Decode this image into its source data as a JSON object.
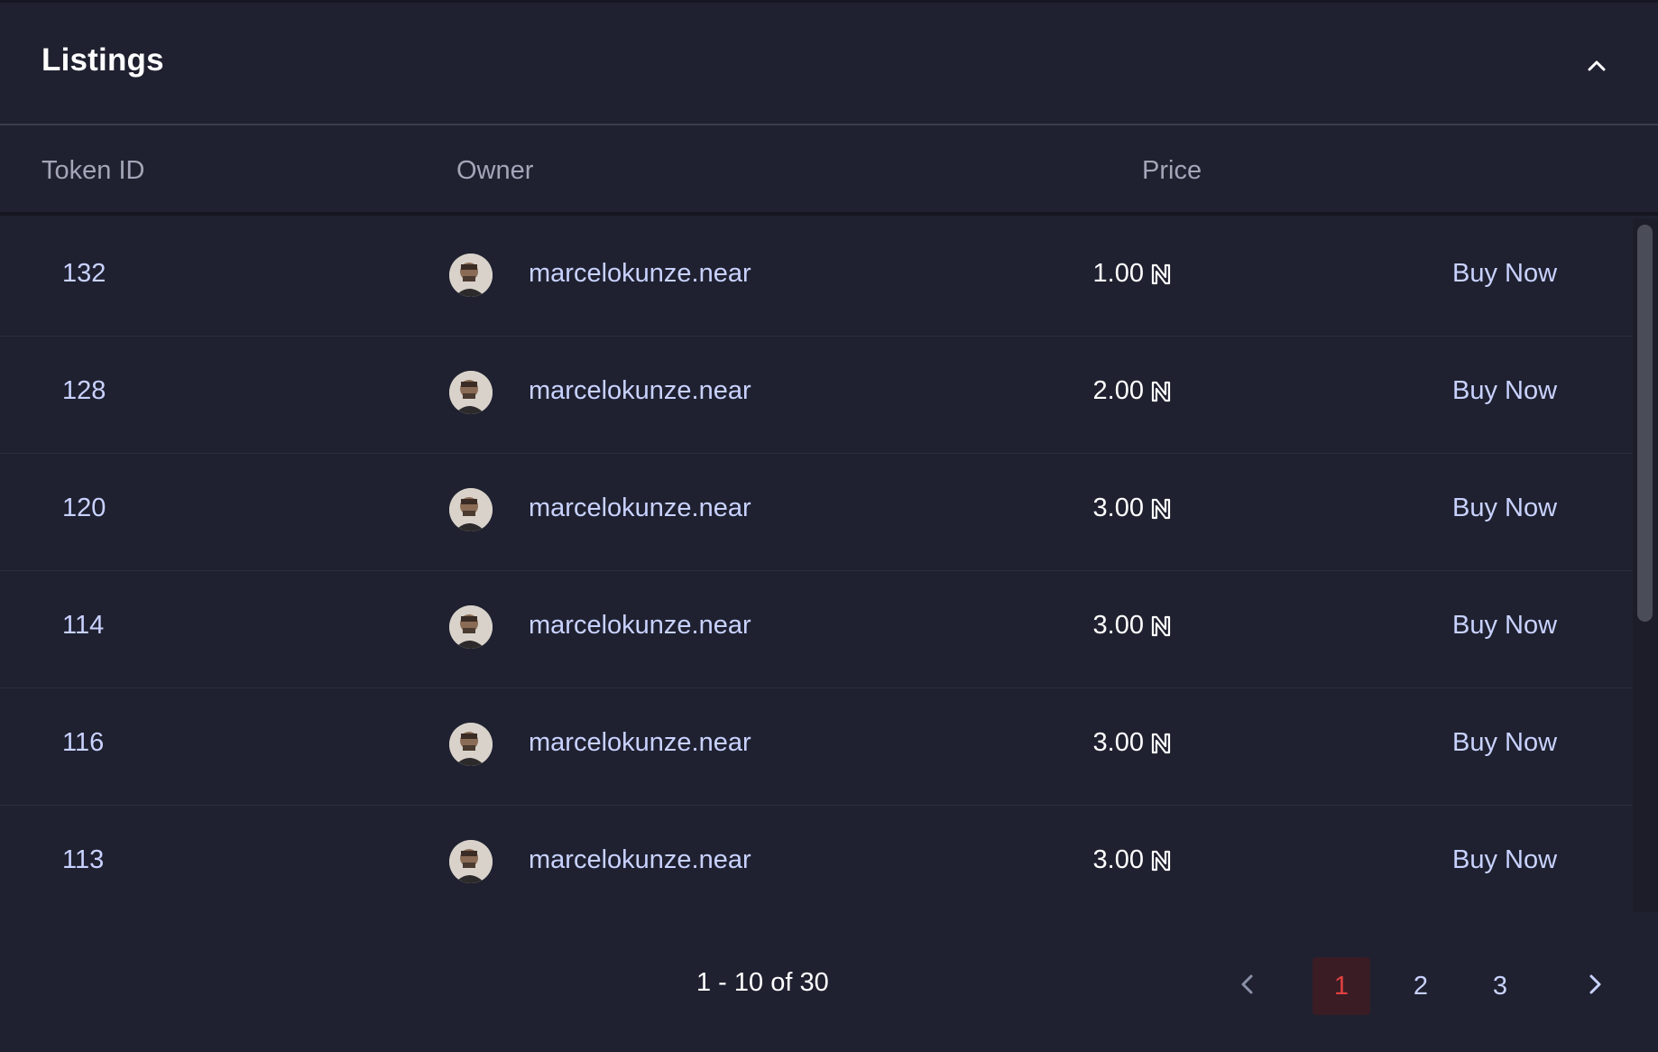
{
  "panel": {
    "title": "Listings",
    "collapse_icon": "chevron-up-icon"
  },
  "columns": {
    "token_id": "Token ID",
    "owner": "Owner",
    "price": "Price"
  },
  "rows": [
    {
      "token_id": "132",
      "owner": "marcelokunze.near",
      "price": "1.00",
      "action": "Buy Now"
    },
    {
      "token_id": "128",
      "owner": "marcelokunze.near",
      "price": "2.00",
      "action": "Buy Now"
    },
    {
      "token_id": "120",
      "owner": "marcelokunze.near",
      "price": "3.00",
      "action": "Buy Now"
    },
    {
      "token_id": "114",
      "owner": "marcelokunze.near",
      "price": "3.00",
      "action": "Buy Now"
    },
    {
      "token_id": "116",
      "owner": "marcelokunze.near",
      "price": "3.00",
      "action": "Buy Now"
    },
    {
      "token_id": "113",
      "owner": "marcelokunze.near",
      "price": "3.00",
      "action": "Buy Now"
    }
  ],
  "currency_icon": "near-logo-icon",
  "pagination": {
    "range_text": "1 - 10 of 30",
    "pages": [
      "1",
      "2",
      "3"
    ],
    "active_page": "1",
    "prev_icon": "chevron-left-icon",
    "next_icon": "chevron-right-icon"
  },
  "colors": {
    "background": "#1f2130",
    "accent_text": "#c9d2ff",
    "active_page_text": "#e0413f",
    "active_page_bg": "#3a1c25"
  }
}
